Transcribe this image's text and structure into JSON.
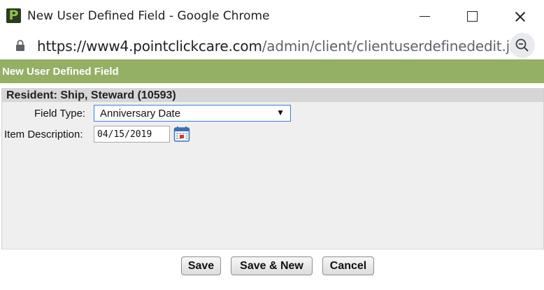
{
  "window": {
    "title": "New User Defined Field - Google Chrome",
    "app_icon_letter": "P"
  },
  "address_bar": {
    "url_host": "https://www4.pointclickcare.com",
    "url_path": "/admin/client/clientuserdefinededit.js..."
  },
  "page": {
    "header": "New User Defined Field",
    "panel_title": "Resident: Ship, Steward (10593)"
  },
  "form": {
    "field_type_label": "Field Type:",
    "field_type_value": "Anniversary Date",
    "item_description_label": "Item Description:",
    "item_description_value": "04/15/2019"
  },
  "buttons": {
    "save": "Save",
    "save_new": "Save & New",
    "cancel": "Cancel"
  },
  "colors": {
    "header_bg": "#94b064",
    "panel_bg": "#efefef",
    "panel_title_bg": "#d6d6d6",
    "select_border": "#3c7fd8"
  }
}
